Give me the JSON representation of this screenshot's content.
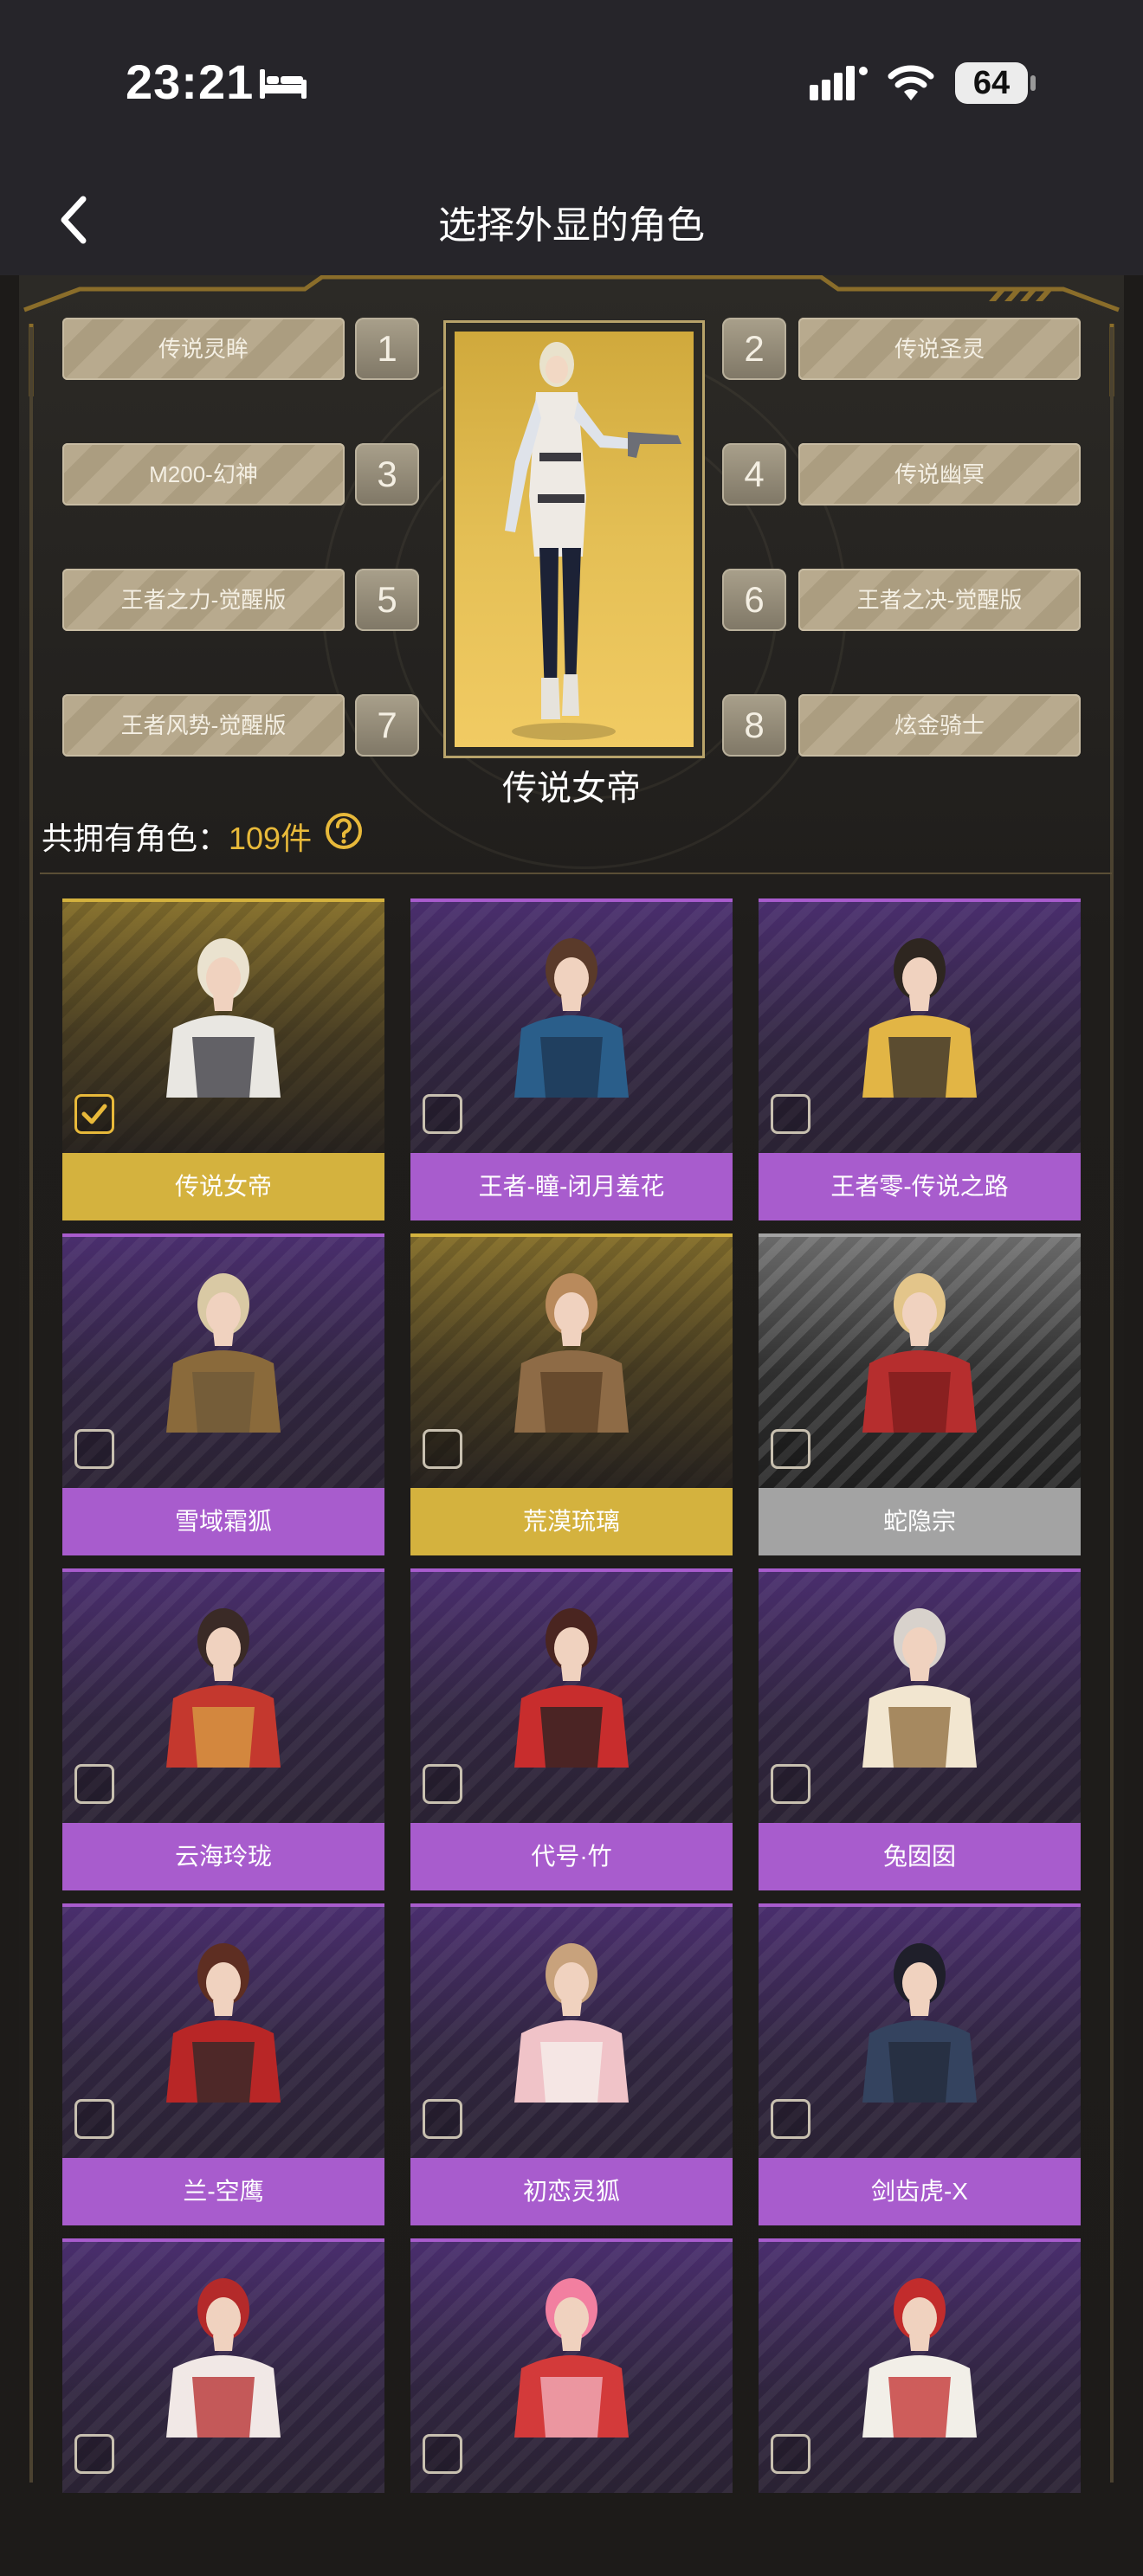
{
  "status_bar": {
    "time": "23:21",
    "battery": "64"
  },
  "nav": {
    "title": "选择外显的角色"
  },
  "slots": [
    {
      "label": "传说灵眸",
      "num": "1"
    },
    {
      "label": "传说圣灵",
      "num": "2"
    },
    {
      "label": "M200-幻神",
      "num": "3"
    },
    {
      "label": "传说幽冥",
      "num": "4"
    },
    {
      "label": "王者之力-觉醒版",
      "num": "5"
    },
    {
      "label": "王者之决-觉醒版",
      "num": "6"
    },
    {
      "label": "王者风势-觉醒版",
      "num": "7"
    },
    {
      "label": "炫金骑士",
      "num": "8"
    }
  ],
  "featured": {
    "name": "传说女帝"
  },
  "owned": {
    "label": "共拥有角色：",
    "count": "109件"
  },
  "colors": {
    "purple": "#a85ccd",
    "gold": "#d4b23e",
    "gray": "#a3a3a3",
    "accent": "#e8b93a"
  },
  "characters": [
    {
      "name": "传说女帝",
      "rarity": "gold",
      "checked": true
    },
    {
      "name": "王者-瞳-闭月羞花",
      "rarity": "purple",
      "checked": false
    },
    {
      "name": "王者零-传说之路",
      "rarity": "purple",
      "checked": false
    },
    {
      "name": "雪域霜狐",
      "rarity": "purple",
      "checked": false
    },
    {
      "name": "荒漠琉璃",
      "rarity": "gold",
      "checked": false
    },
    {
      "name": "蛇隐宗",
      "rarity": "gray",
      "checked": false
    },
    {
      "name": "云海玲珑",
      "rarity": "purple",
      "checked": false
    },
    {
      "name": "代号·竹",
      "rarity": "purple",
      "checked": false
    },
    {
      "name": "兔囡囡",
      "rarity": "purple",
      "checked": false
    },
    {
      "name": "兰-空鹰",
      "rarity": "purple",
      "checked": false
    },
    {
      "name": "初恋灵狐",
      "rarity": "purple",
      "checked": false
    },
    {
      "name": "剑齿虎-X",
      "rarity": "purple",
      "checked": false
    },
    {
      "name": "",
      "rarity": "purple",
      "checked": false
    },
    {
      "name": "",
      "rarity": "purple",
      "checked": false
    },
    {
      "name": "",
      "rarity": "purple",
      "checked": false
    }
  ]
}
